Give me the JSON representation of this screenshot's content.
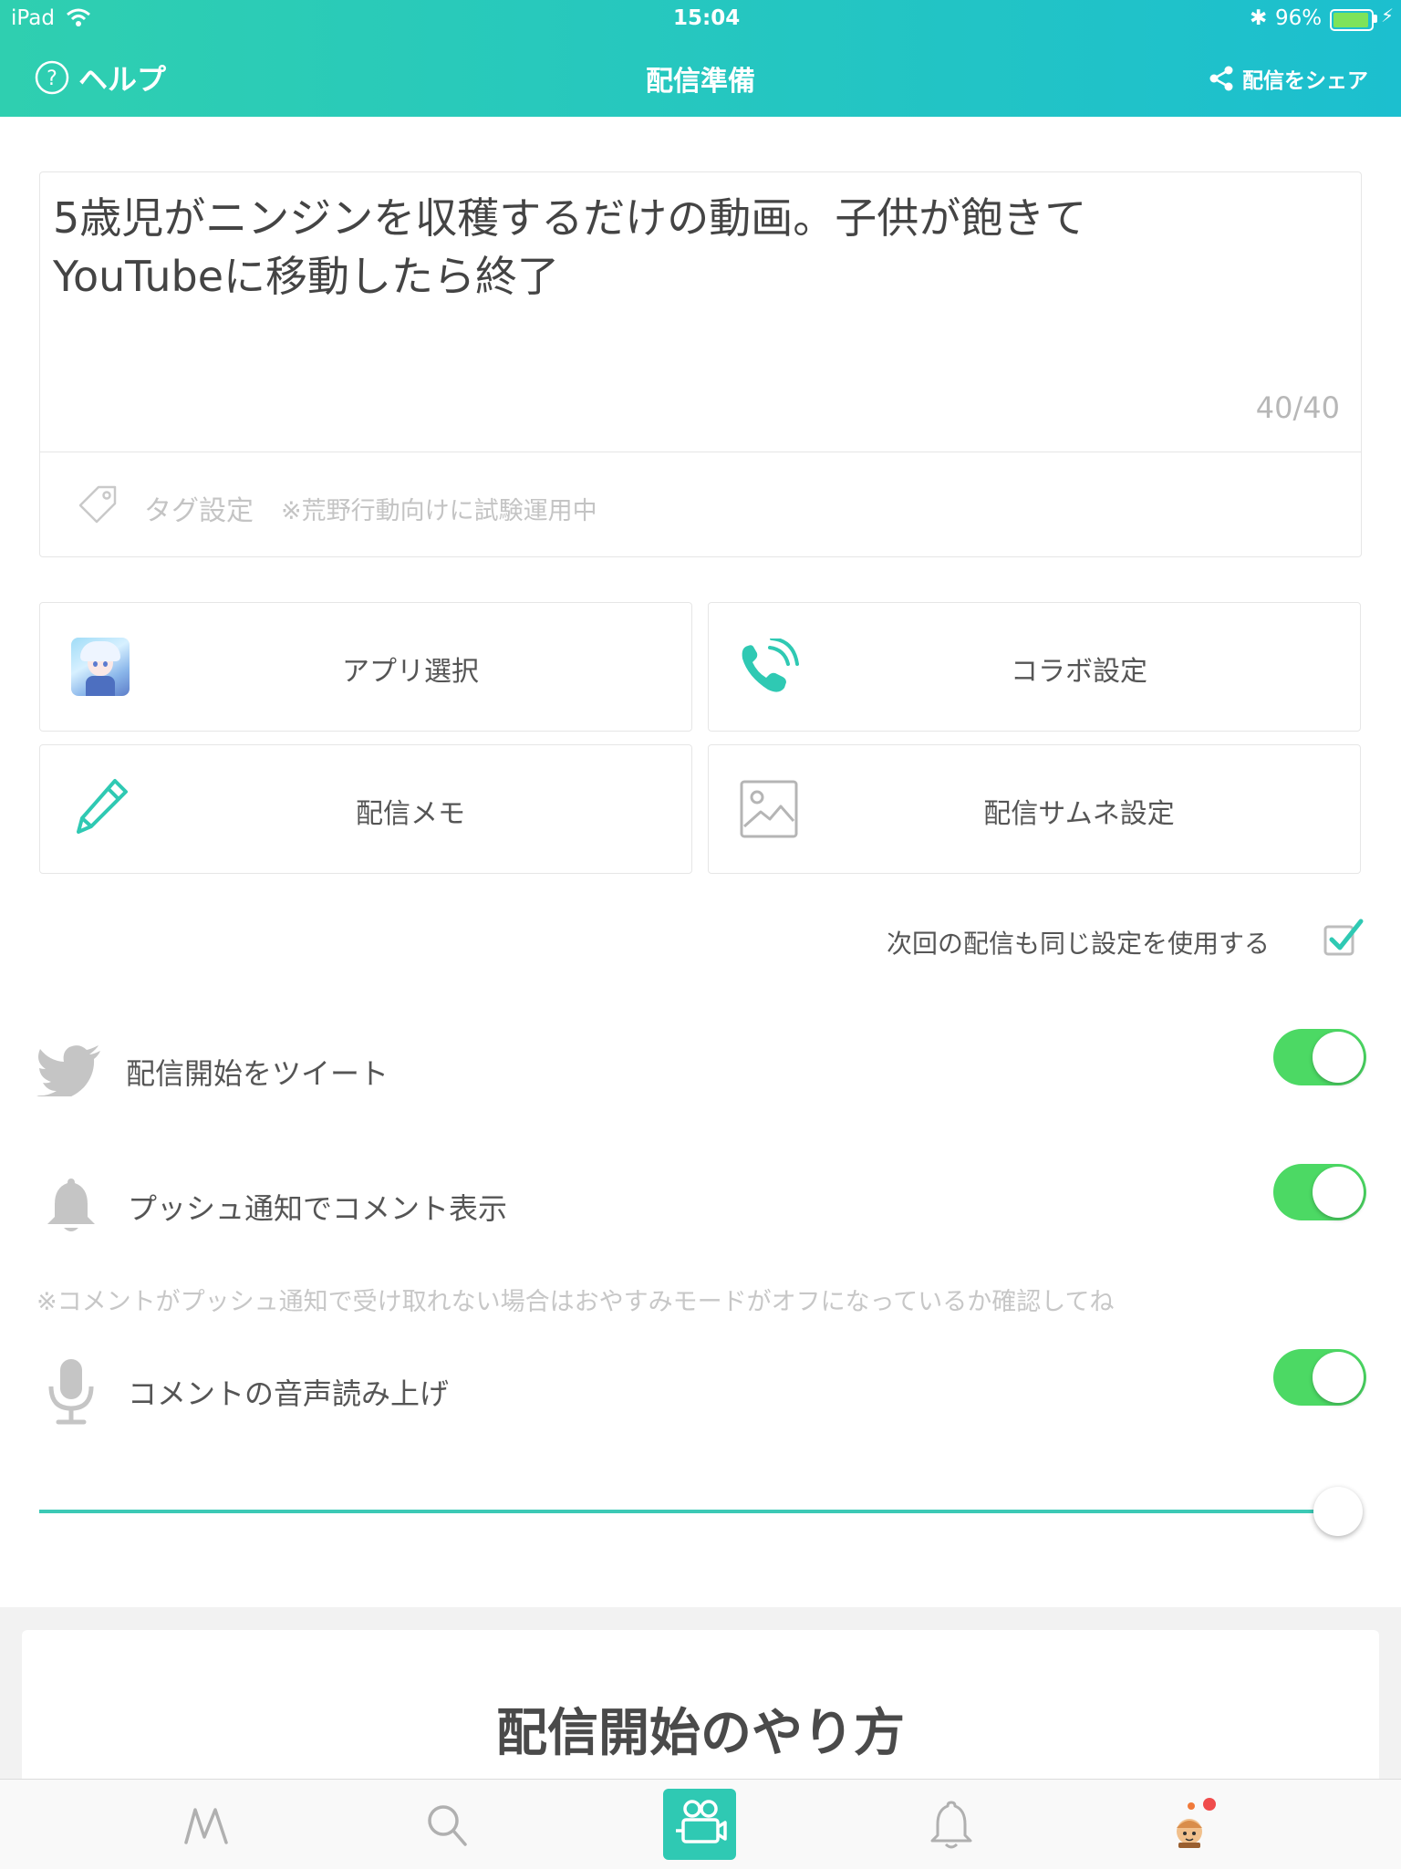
{
  "status_bar": {
    "device": "iPad",
    "time": "15:04",
    "battery": "96%"
  },
  "nav": {
    "help_label": "ヘルプ",
    "title": "配信準備",
    "share_label": "配信をシェア"
  },
  "title_input": {
    "value": "5歳児がニンジンを収穫するだけの動画。子供が飽きて\nYouTubeに移動したら終了",
    "char_count": "40/40"
  },
  "tags": {
    "label": "タグ設定",
    "note": "※荒野行動向けに試験運用中"
  },
  "tiles": {
    "app_select": "アプリ選択",
    "collab": "コラボ設定",
    "memo": "配信メモ",
    "thumbnail": "配信サムネ設定"
  },
  "same_settings": {
    "label": "次回の配信も同じ設定を使用する",
    "checked": true
  },
  "toggles": [
    {
      "label": "配信開始をツイート",
      "on": true,
      "icon": "twitter-icon"
    },
    {
      "label": "プッシュ通知でコメント表示",
      "on": true,
      "icon": "bell-icon"
    },
    {
      "label": "コメントの音声読み上げ",
      "on": true,
      "icon": "microphone-icon"
    }
  ],
  "push_note": "※コメントがプッシュ通知で受け取れない場合はおやすみモードがオフになっているか確認してね",
  "volume_slider": {
    "value": 1.0
  },
  "howto": {
    "title": "配信開始のやり方"
  },
  "tabbar": {
    "items": [
      {
        "icon": "mirrativ-logo-icon",
        "active": false
      },
      {
        "icon": "search-icon",
        "active": false
      },
      {
        "icon": "broadcast-camera-icon",
        "active": true
      },
      {
        "icon": "bell-icon",
        "active": false
      },
      {
        "icon": "profile-avatar-icon",
        "active": false,
        "badge": true
      }
    ]
  },
  "colors": {
    "accent": "#2fc9b3",
    "toggle_on": "#4cd964",
    "badge": "#f04c4c"
  }
}
